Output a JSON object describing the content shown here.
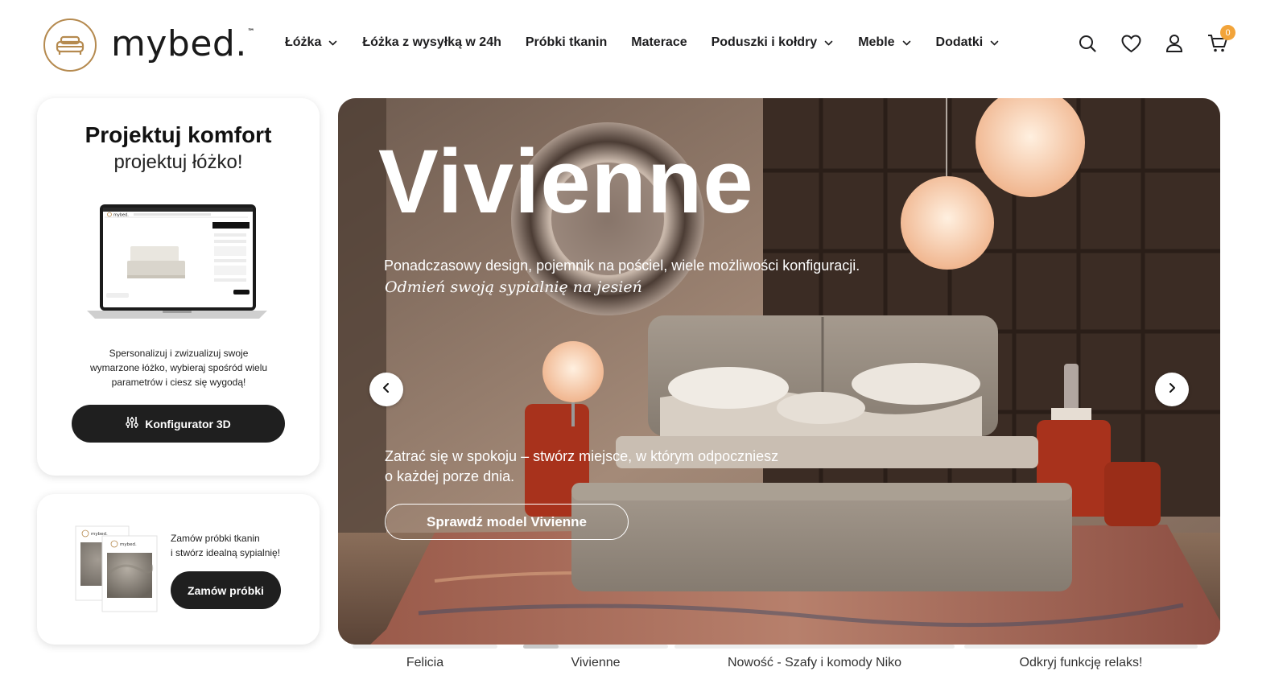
{
  "brand": {
    "name": "mybed.",
    "tm": "™",
    "accent": "#b58a4f"
  },
  "nav": {
    "items": [
      {
        "label": "Łóżka",
        "dropdown": true
      },
      {
        "label": "Łóżka z wysyłką w 24h",
        "dropdown": false
      },
      {
        "label": "Próbki tkanin",
        "dropdown": false
      },
      {
        "label": "Materace",
        "dropdown": false
      },
      {
        "label": "Poduszki i kołdry",
        "dropdown": true
      },
      {
        "label": "Meble",
        "dropdown": true
      },
      {
        "label": "Dodatki",
        "dropdown": true
      }
    ]
  },
  "header_icons": {
    "icons": [
      "search-icon",
      "heart-icon",
      "user-icon",
      "cart-icon"
    ],
    "cart_count": "0",
    "badge_color": "#f2a43a"
  },
  "configurator_card": {
    "title": "Projektuj komfort",
    "subtitle": "projektuj łóżko!",
    "description": "Spersonalizuj i zwizualizuj swoje wymarzone łóżko, wybieraj spośród wielu parametrów i ciesz się wygodą!",
    "button_label": "Konfigurator 3D",
    "button_icon": "sliders-icon",
    "screen_brand": "mybed."
  },
  "samples_card": {
    "line1": "Zamów próbki tkanin",
    "line2": "i stwórz idealną sypialnię!",
    "button_label": "Zamów próbki",
    "swatch_brand": "mybed."
  },
  "hero": {
    "title": "Vivienne",
    "subtitle": "Ponadczasowy design, pojemnik na pościel, wiele możliwości konfiguracji.",
    "italic": "Odmień swoją sypialnię na jesień",
    "desc_line1": "Zatrać się w spokoju – stwórz miejsce, w którym odpoczniesz",
    "desc_line2": "o każdej porze dnia.",
    "cta_label": "Sprawdź model Vivienne"
  },
  "slider_tabs": [
    {
      "label": "Felicia",
      "progress": 0
    },
    {
      "label": "Vivienne",
      "progress": 0.16
    },
    {
      "label": "Nowość - Szafy i komody Niko",
      "progress": 0
    },
    {
      "label": "Odkryj funkcję relaks!",
      "progress": 0
    }
  ]
}
